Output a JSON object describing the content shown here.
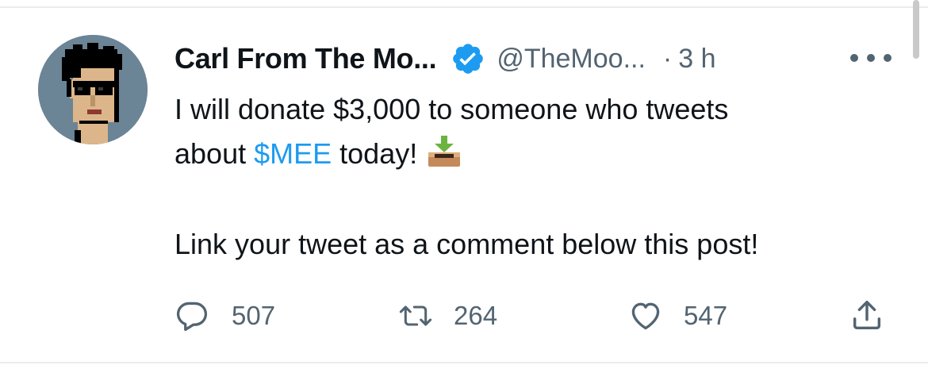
{
  "tweet": {
    "author_name": "Carl From The Mo...",
    "handle": "@TheMoo...",
    "separator": "·",
    "time": "3 h",
    "text_line1": "I will donate $3,000 to someone who tweets",
    "text_line2_prefix": "about ",
    "cashtag": "$MEE",
    "text_line2_suffix": " today!",
    "text_line3": "Link your tweet as a comment below this post!",
    "emoji": "inbox-tray-emoji"
  },
  "actions": {
    "replies": "507",
    "retweets": "264",
    "likes": "547"
  },
  "icons": {
    "verified": "verified-badge-icon",
    "more": "more-options-icon",
    "reply": "reply-icon",
    "retweet": "retweet-icon",
    "like": "heart-icon",
    "share": "share-icon"
  },
  "colors": {
    "accent": "#1d9bf0",
    "secondary_text": "#536471",
    "primary_text": "#0f1419"
  }
}
